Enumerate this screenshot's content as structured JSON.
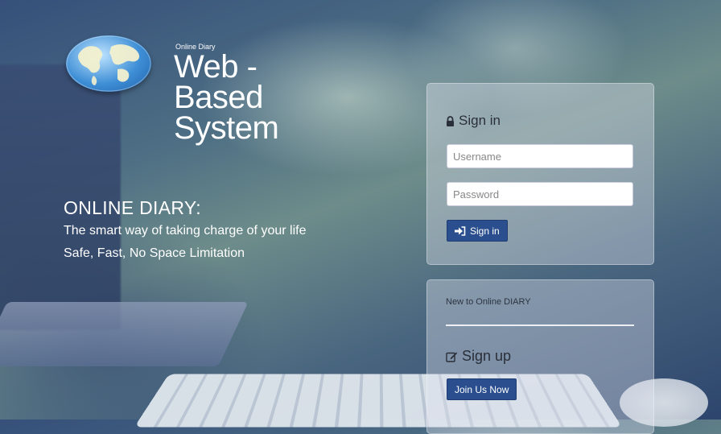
{
  "brand": {
    "small": "Online Diary",
    "line1": "Web -",
    "line2": "Based",
    "line3": "System"
  },
  "hero": {
    "title": "ONLINE DIARY:",
    "line1": "The smart way of taking charge of your life",
    "line2": "Safe, Fast, No Space Limitation"
  },
  "signin": {
    "heading": "Sign in",
    "username_placeholder": "Username",
    "password_placeholder": "Password",
    "button": "Sign in"
  },
  "signup": {
    "intro": "New to Online DIARY",
    "heading": "Sign up",
    "button": "Join Us Now"
  },
  "icons": {
    "lock": "lock-icon",
    "signin": "sign-in-icon",
    "edit": "edit-icon",
    "globe": "globe-icon"
  },
  "colors": {
    "primary_button": "#2b4f8e",
    "panel": "rgba(225,230,240,0.38)"
  }
}
